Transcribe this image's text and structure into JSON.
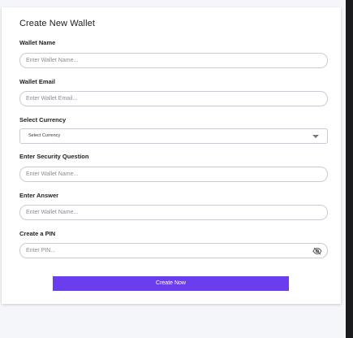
{
  "form": {
    "title": "Create New Wallet",
    "wallet_name": {
      "label": "Wallet Name",
      "placeholder": "Enter Wallet Name..."
    },
    "wallet_email": {
      "label": "Wallet Email",
      "placeholder": "Enter Wallet Email..."
    },
    "currency": {
      "label": "Select Currency",
      "selected": "Select Currency"
    },
    "security_question": {
      "label": "Enter Security Question",
      "placeholder": "Enter Wallet Name..."
    },
    "answer": {
      "label": "Enter Answer",
      "placeholder": "Enter Wallet Name..."
    },
    "pin": {
      "label": "Create a PIN",
      "placeholder": "Enter PIN...",
      "toggle_icon": "eye-slash-icon"
    },
    "submit_label": "Create Now"
  },
  "colors": {
    "accent": "#6a3dee",
    "background": "#f5f6fa",
    "card": "#ffffff",
    "border": "#c9ccd3"
  }
}
